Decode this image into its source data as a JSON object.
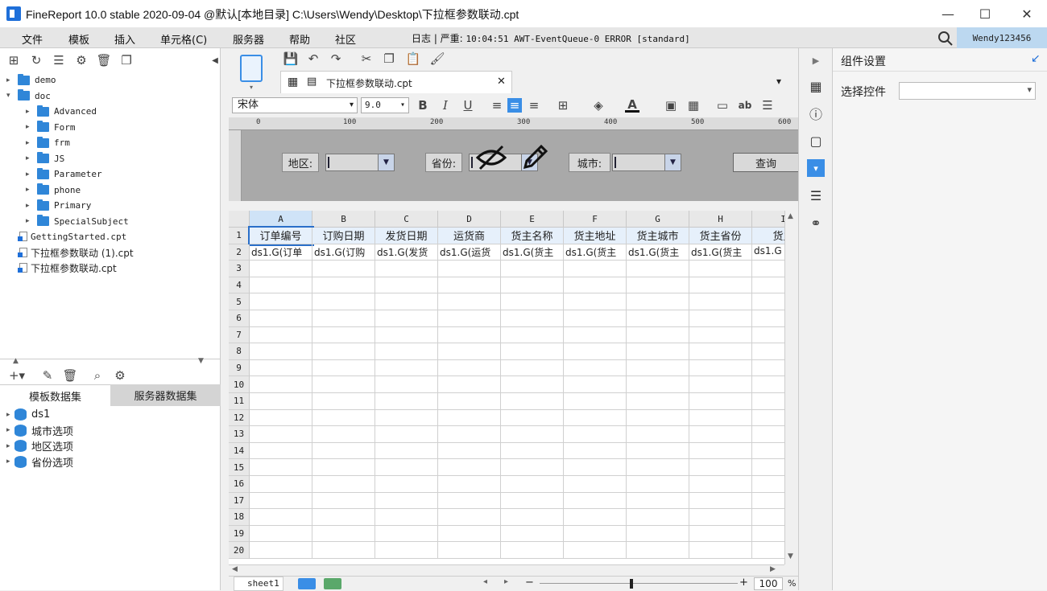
{
  "window": {
    "title": "FineReport 10.0 stable 2020-09-04 @默认[本地目录]    C:\\Users\\Wendy\\Desktop\\下拉框参数联动.cpt",
    "minimize": "—",
    "maximize": "☐",
    "close": "✕"
  },
  "menu": {
    "items": [
      "文件",
      "模板",
      "插入",
      "单元格(C)",
      "服务器",
      "帮助",
      "社区"
    ],
    "log_prefix": "日志 | 严重:",
    "log_message": "10:04:51 AWT-EventQueue-0 ERROR [standard]",
    "user": "Wendy123456"
  },
  "file_tree": {
    "items": [
      {
        "label": "demo",
        "type": "folder",
        "level": 0,
        "expanded": false
      },
      {
        "label": "doc",
        "type": "folder",
        "level": 0,
        "expanded": true
      },
      {
        "label": "Advanced",
        "type": "folder",
        "level": 1,
        "expanded": false
      },
      {
        "label": "Form",
        "type": "folder",
        "level": 1,
        "expanded": false
      },
      {
        "label": "frm",
        "type": "folder",
        "level": 1,
        "expanded": false
      },
      {
        "label": "JS",
        "type": "folder",
        "level": 1,
        "expanded": false
      },
      {
        "label": "Parameter",
        "type": "folder",
        "level": 1,
        "expanded": false
      },
      {
        "label": "phone",
        "type": "folder",
        "level": 1,
        "expanded": false
      },
      {
        "label": "Primary",
        "type": "folder",
        "level": 1,
        "expanded": false
      },
      {
        "label": "SpecialSubject",
        "type": "folder",
        "level": 1,
        "expanded": false
      },
      {
        "label": "GettingStarted.cpt",
        "type": "file",
        "level": 0
      },
      {
        "label": "下拉框参数联动 (1).cpt",
        "type": "file",
        "level": 0
      },
      {
        "label": "下拉框参数联动.cpt",
        "type": "file",
        "level": 0
      }
    ]
  },
  "datasets": {
    "tabs": [
      "模板数据集",
      "服务器数据集"
    ],
    "active_tab": 0,
    "items": [
      "ds1",
      "城市选项",
      "地区选项",
      "省份选项"
    ]
  },
  "editor": {
    "tab_label": "下拉框参数联动.cpt",
    "font_name": "宋体",
    "font_size": "9.0",
    "ruler_ticks": [
      "0",
      "100",
      "200",
      "300",
      "400",
      "500",
      "600"
    ],
    "parameters": {
      "region_label": "地区:",
      "province_label": "省份:",
      "city_label": "城市:",
      "query_button": "查询"
    }
  },
  "grid": {
    "columns": [
      "A",
      "B",
      "C",
      "D",
      "E",
      "F",
      "G",
      "H",
      "I"
    ],
    "row_numbers": [
      "1",
      "2",
      "3",
      "4",
      "5",
      "6",
      "7",
      "8",
      "9",
      "10",
      "11",
      "12",
      "13",
      "14",
      "15",
      "16",
      "17",
      "18",
      "19",
      "20"
    ],
    "headers": [
      "订单编号",
      "订购日期",
      "发货日期",
      "运货商",
      "货主名称",
      "货主地址",
      "货主城市",
      "货主省份",
      "货主"
    ],
    "row2": [
      "ds1.G(订单",
      "ds1.G(订购",
      "ds1.G(发货",
      "ds1.G(运货",
      "ds1.G(货主",
      "ds1.G(货主",
      "ds1.G(货主",
      "ds1.G(货主",
      "ds1.G"
    ]
  },
  "footer": {
    "sheet_name": "sheet1",
    "zoom": "100",
    "zoom_unit": "%"
  },
  "right_panel": {
    "title": "组件设置",
    "select_label": "选择控件",
    "select_value": ""
  }
}
